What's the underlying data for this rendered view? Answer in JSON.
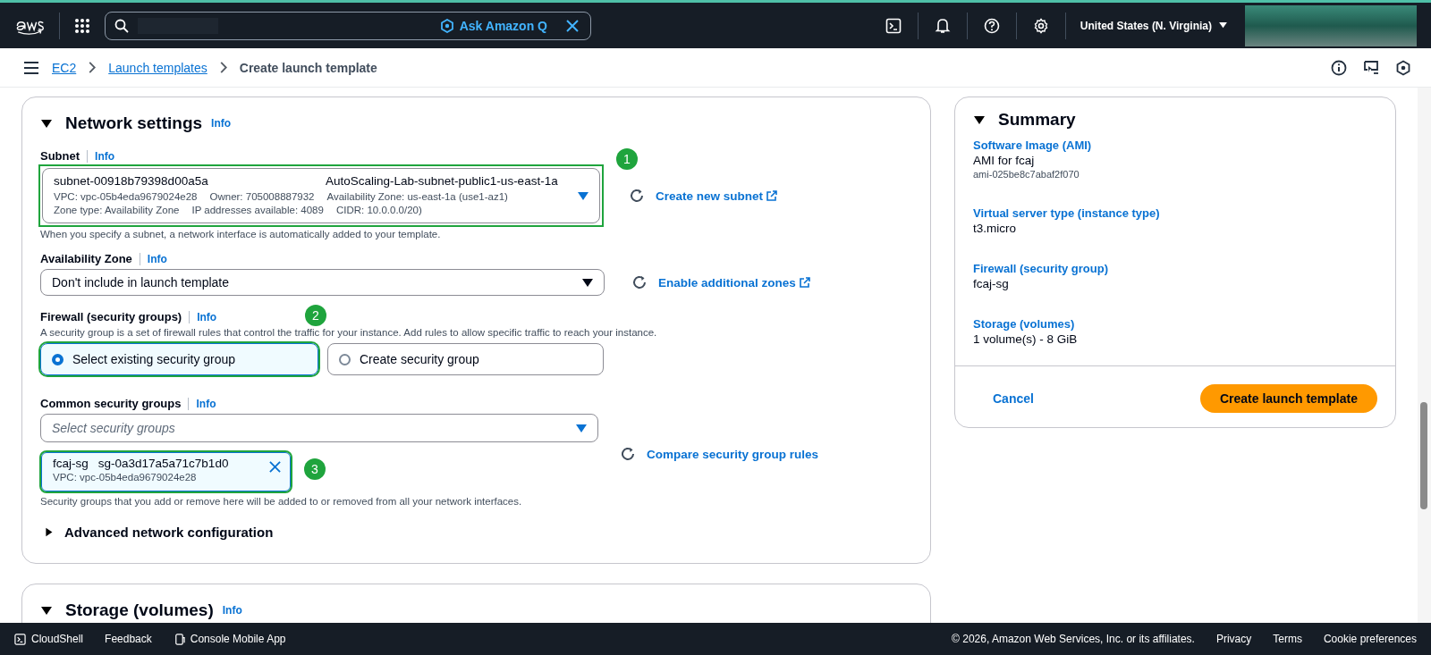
{
  "top_nav": {
    "ask_label": "Ask Amazon Q",
    "region": "United States (N. Virginia)"
  },
  "breadcrumb": [
    {
      "label": "EC2",
      "link": true
    },
    {
      "label": "Launch templates",
      "link": true
    },
    {
      "label": "Create launch template",
      "link": false
    }
  ],
  "network_settings": {
    "title": "Network settings",
    "info": "Info",
    "expanded": true,
    "subnet": {
      "label": "Subnet",
      "info": "Info",
      "id": "subnet-00918b79398d00a5a",
      "name": "AutoScaling-Lab-subnet-public1-us-east-1a",
      "details": [
        [
          "VPC: vpc-05b4eda9679024e28",
          "Owner: 705008887932",
          "Availability Zone: us-east-1a (use1-az1)"
        ],
        [
          "Zone type: Availability Zone",
          "IP addresses available: 4089",
          "CIDR: 10.0.0.0/20)"
        ]
      ],
      "annotation": "1",
      "action": "Create new subnet",
      "hint": "When you specify a subnet, a network interface is automatically added to your template."
    },
    "availability_zone": {
      "label": "Availability Zone",
      "info": "Info",
      "value": "Don't include in launch template",
      "action": "Enable additional zones"
    },
    "firewall": {
      "label": "Firewall (security groups)",
      "info": "Info",
      "annotation": "2",
      "description": "A security group is a set of firewall rules that control the traffic for your instance. Add rules to allow specific traffic to reach your instance.",
      "options": [
        {
          "label": "Select existing security group",
          "selected": true
        },
        {
          "label": "Create security group",
          "selected": false
        }
      ]
    },
    "common_security_groups": {
      "label": "Common security groups",
      "info": "Info",
      "placeholder": "Select security groups",
      "chips": [
        {
          "name": "fcaj-sg",
          "id": "sg-0a3d17a5a71c7b1d0",
          "vpc": "VPC: vpc-05b4eda9679024e28",
          "annotation": "3"
        }
      ],
      "action": "Compare security group rules",
      "hint": "Security groups that you add or remove here will be added to or removed from all your network interfaces."
    },
    "advanced": {
      "label": "Advanced network configuration",
      "expanded": false
    }
  },
  "storage": {
    "title": "Storage (volumes)",
    "info": "Info",
    "expanded": true
  },
  "summary": {
    "title": "Summary",
    "expanded": true,
    "items": [
      {
        "label": "Software Image (AMI)",
        "value": "AMI for fcaj",
        "sub": "ami-025be8c7abaf2f070"
      },
      {
        "label": "Virtual server type (instance type)",
        "value": "t3.micro"
      },
      {
        "label": "Firewall (security group)",
        "value": "fcaj-sg"
      },
      {
        "label": "Storage (volumes)",
        "value": "1 volume(s) - 8 GiB"
      }
    ],
    "cancel": "Cancel",
    "create": "Create launch template"
  },
  "footer": {
    "left": [
      "CloudShell",
      "Feedback",
      "Console Mobile App"
    ],
    "copyright": "© 2026, Amazon Web Services, Inc. or its affiliates.",
    "links": [
      "Privacy",
      "Terms",
      "Cookie preferences"
    ]
  }
}
